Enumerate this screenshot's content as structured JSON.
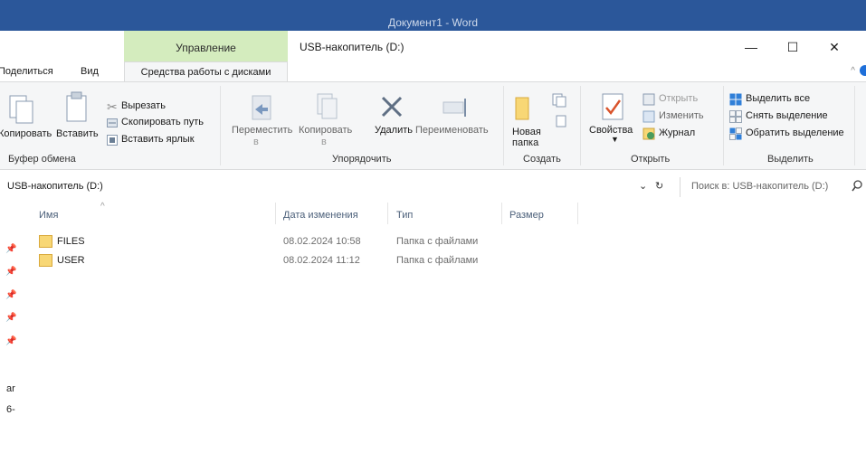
{
  "word": {
    "title": "Документ1  -  Word"
  },
  "explorer": {
    "manage_tab": "Управление",
    "title": "USB-накопитель (D:)",
    "window_controls": {
      "minimize": "—",
      "maximize": "☐",
      "close": "✕"
    }
  },
  "tabs": {
    "share": "Поделиться",
    "view": "Вид",
    "disk_tools": "Средства работы с дисками",
    "collapse": "^"
  },
  "ribbon": {
    "clipboard": {
      "copy": "Копировать",
      "paste": "Вставить",
      "cut": "Вырезать",
      "copy_path": "Скопировать путь",
      "paste_shortcut": "Вставить ярлык",
      "group": "Буфер обмена"
    },
    "organize": {
      "move_line1": "Переместить",
      "move_line2": "в",
      "copy_line1": "Копировать",
      "copy_line2": "в",
      "delete": "Удалить",
      "rename": "Переименовать",
      "group": "Упорядочить"
    },
    "new": {
      "new_folder_line1": "Новая",
      "new_folder_line2": "папка",
      "group": "Создать"
    },
    "open": {
      "properties": "Свойства",
      "open": "Открыть",
      "edit": "Изменить",
      "history": "Журнал",
      "group": "Открыть"
    },
    "select": {
      "select_all": "Выделить все",
      "select_none": "Снять выделение",
      "invert": "Обратить выделение",
      "group": "Выделить"
    }
  },
  "address": {
    "path": "USB-накопитель (D:)",
    "dropdown": "⌄",
    "refresh": "↻",
    "search_placeholder": "Поиск в: USB-накопитель (D:)"
  },
  "columns": {
    "name": "Имя",
    "date": "Дата изменения",
    "type": "Тип",
    "size": "Размер"
  },
  "files": [
    {
      "name": "FILES",
      "date": "08.02.2024 10:58",
      "type": "Папка с файлами"
    },
    {
      "name": "USER",
      "date": "08.02.2024 11:12",
      "type": "Папка с файлами"
    }
  ],
  "left_fragments": [
    "ar",
    "6-"
  ],
  "colors": {
    "word_blue": "#2b579a",
    "manage_green": "#d4ecbe",
    "ribbon_bg": "#f5f6f7",
    "folder_yellow": "#f8d775"
  }
}
